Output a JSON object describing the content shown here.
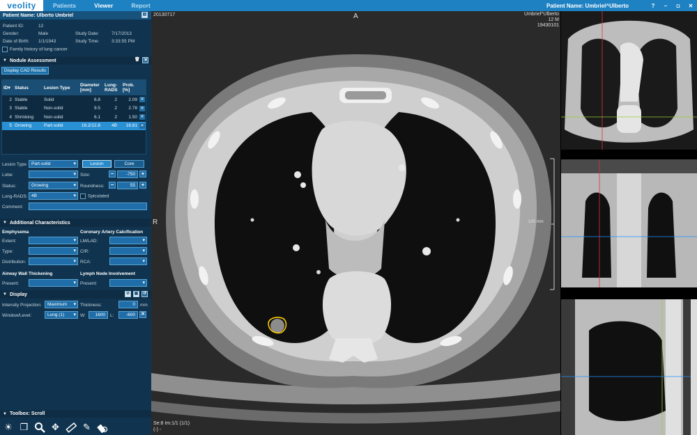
{
  "app": {
    "logo": "veolity",
    "nav": [
      "Patients",
      "Viewer",
      "Report"
    ],
    "patient_title": "Patient Name: Umbriel^Ulberto",
    "window_buttons": [
      "?",
      "–",
      "◘",
      "✕"
    ]
  },
  "patient": {
    "name_label": "Patient Name: Ulberto Umbriel",
    "id_label": "Patient ID:",
    "id_value": "12",
    "gender_label": "Gender:",
    "gender_value": "Male",
    "study_date_label": "Study Date:",
    "study_date_value": "7/17/2013",
    "dob_label": "Date of Birth:",
    "dob_value": "1/1/1943",
    "study_time_label": "Study Time:",
    "study_time_value": "3:33:55 PM",
    "family_history": "Family history of lung cancer"
  },
  "nodule": {
    "title": "Nodule Assessment",
    "cad_button": "Display CAD Results",
    "columns": [
      "ID▾",
      "Status",
      "Lesion Type",
      "Diameter [mm]",
      "Lung-RADS",
      "Prob. [%]"
    ],
    "rows": [
      {
        "id": "2",
        "status": "Stable",
        "type": "Solid",
        "diameter": "6.8",
        "lungrads": "2",
        "prob": "2.09",
        "selected": false
      },
      {
        "id": "3",
        "status": "Stable",
        "type": "Non-solid",
        "diameter": "9.5",
        "lungrads": "2",
        "prob": "2.78",
        "selected": false
      },
      {
        "id": "4",
        "status": "Shrinking",
        "type": "Non-solid",
        "diameter": "6.1",
        "lungrads": "2",
        "prob": "1.50",
        "selected": false
      },
      {
        "id": "5",
        "status": "Growing",
        "type": "Part-solid",
        "diameter": "16.2/12.8",
        "lungrads": "4B",
        "prob": "16.81",
        "selected": true
      }
    ],
    "lesion_type_label": "Lesion Type",
    "lesion_type_value": "Part-solid",
    "lesion_tab": "Lesion",
    "core_tab": "Core",
    "lobe_label": "Lobe:",
    "lobe_value": "",
    "size_label": "Size:",
    "size_value": "-750",
    "status_label": "Status:",
    "status_value": "Growing",
    "roundness_label": "Roundness:",
    "roundness_value": "55",
    "lungrads_label": "Lung-RADS:",
    "lungrads_value": "4B",
    "spiculated_label": "Spiculated",
    "comment_label": "Comment:"
  },
  "additional": {
    "title": "Additional Characteristics",
    "emphysema": "Emphysema",
    "extent": "Extent:",
    "type": "Type:",
    "distribution": "Distribution:",
    "cac": "Coronary Artery Calcification",
    "lmlad": "LM/LAD:",
    "cir": "CIR:",
    "rca": "RCA:",
    "awt": "Airway Wall Thickening",
    "awt_present": "Present:",
    "lni": "Lymph Node Involvement",
    "lni_present": "Present:"
  },
  "display": {
    "title": "Display",
    "intensity_label": "Intensity Projection:",
    "intensity_value": "Maximum",
    "thickness_label": "Thickness:",
    "thickness_value": "0",
    "thickness_unit": "mm",
    "wl_label": "Window/Level:",
    "wl_value": "Lung (1)",
    "w_label": "W:",
    "w_value": "1600",
    "l_label": "L:",
    "l_value": "-600"
  },
  "toolbox": {
    "title": "Toolbox: Scroll"
  },
  "viewer": {
    "top_left": "20130717",
    "top_center": "A",
    "top_right_1": "Umbriel^Ulberto",
    "top_right_2": "12 M",
    "top_right_3": "19430101",
    "left_mid": "R",
    "scale": "100 mm",
    "bottom_left_1": "Se:8 Im:1/1 (1/1)",
    "bottom_left_2": "(-) -"
  }
}
